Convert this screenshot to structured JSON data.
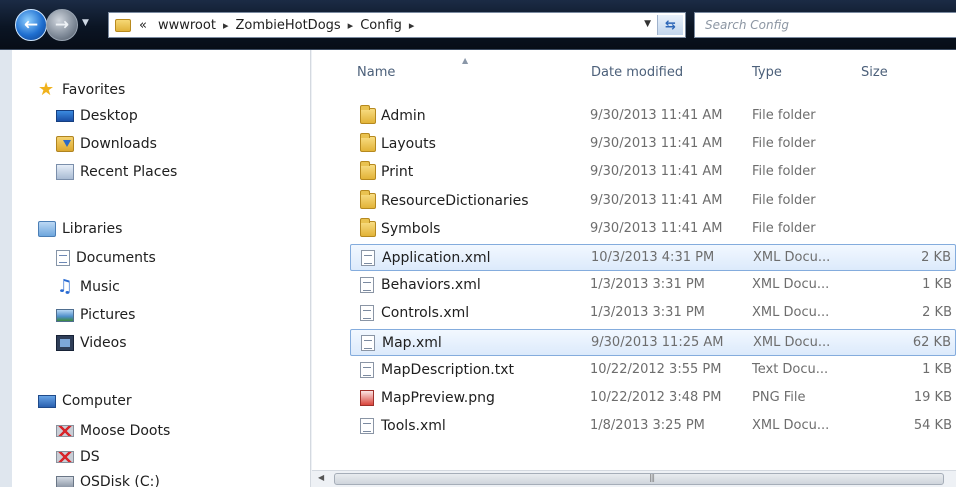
{
  "address_bar": {
    "overflow": "«",
    "crumbs": [
      "wwwroot",
      "ZombieHotDogs",
      "Config"
    ]
  },
  "search": {
    "placeholder": "Search Config"
  },
  "nav_pane": {
    "favorites": {
      "label": "Favorites",
      "items": [
        "Desktop",
        "Downloads",
        "Recent Places"
      ]
    },
    "libraries": {
      "label": "Libraries",
      "items": [
        "Documents",
        "Music",
        "Pictures",
        "Videos"
      ]
    },
    "computer": {
      "label": "Computer",
      "items": [
        "Moose Doots",
        "DS",
        "OSDisk (C:)"
      ]
    }
  },
  "columns": {
    "name": "Name",
    "date": "Date modified",
    "type": "Type",
    "size": "Size"
  },
  "files": [
    {
      "name": "Admin",
      "date": "9/30/2013 11:41 AM",
      "type": "File folder",
      "size": "",
      "icon": "folder-icon",
      "selected": false
    },
    {
      "name": "Layouts",
      "date": "9/30/2013 11:41 AM",
      "type": "File folder",
      "size": "",
      "icon": "folder-icon",
      "selected": false
    },
    {
      "name": "Print",
      "date": "9/30/2013 11:41 AM",
      "type": "File folder",
      "size": "",
      "icon": "folder-icon",
      "selected": false
    },
    {
      "name": "ResourceDictionaries",
      "date": "9/30/2013 11:41 AM",
      "type": "File folder",
      "size": "",
      "icon": "folder-icon",
      "selected": false
    },
    {
      "name": "Symbols",
      "date": "9/30/2013 11:41 AM",
      "type": "File folder",
      "size": "",
      "icon": "folder-icon",
      "selected": false
    },
    {
      "name": "Application.xml",
      "date": "10/3/2013 4:31 PM",
      "type": "XML Docu...",
      "size": "2 KB",
      "icon": "xml-file-icon",
      "selected": true
    },
    {
      "name": "Behaviors.xml",
      "date": "1/3/2013 3:31 PM",
      "type": "XML Docu...",
      "size": "1 KB",
      "icon": "xml-file-icon",
      "selected": false
    },
    {
      "name": "Controls.xml",
      "date": "1/3/2013 3:31 PM",
      "type": "XML Docu...",
      "size": "2 KB",
      "icon": "xml-file-icon",
      "selected": false
    },
    {
      "name": "Map.xml",
      "date": "9/30/2013 11:25 AM",
      "type": "XML Docu...",
      "size": "62 KB",
      "icon": "xml-file-icon",
      "selected": true
    },
    {
      "name": "MapDescription.txt",
      "date": "10/22/2012 3:55 PM",
      "type": "Text Docu...",
      "size": "1 KB",
      "icon": "text-file-icon",
      "selected": false
    },
    {
      "name": "MapPreview.png",
      "date": "10/22/2012 3:48 PM",
      "type": "PNG File",
      "size": "19 KB",
      "icon": "png-file-icon",
      "selected": false
    },
    {
      "name": "Tools.xml",
      "date": "1/8/2013 3:25 PM",
      "type": "XML Docu...",
      "size": "54 KB",
      "icon": "xml-file-icon",
      "selected": false
    }
  ]
}
